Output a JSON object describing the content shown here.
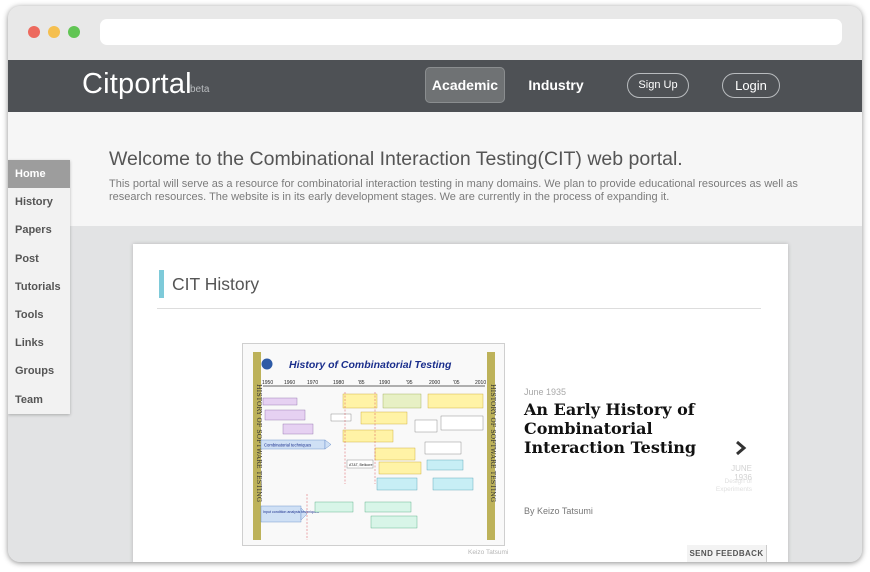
{
  "window": {
    "controls": {
      "close_color": "#ed6a5e",
      "minimize_color": "#f5bf4f",
      "zoom_color": "#61c554"
    },
    "address_bar": ""
  },
  "nav": {
    "brand": "Citportal",
    "beta": "beta",
    "tabs": [
      {
        "label": "Academic",
        "active": true
      },
      {
        "label": "Industry",
        "active": false
      }
    ],
    "sign_up": "Sign Up",
    "login": "Login"
  },
  "hero": {
    "title": "Welcome to the Combinational Interaction Testing(CIT) web portal.",
    "text": "This portal will serve as a resource for combinatorial interaction testing in many domains. We plan to provide educational resources as well as research resources. The website is in its early development stages. We are currently in the process of expanding it."
  },
  "sidebar": {
    "items": [
      {
        "label": "Home",
        "active": true
      },
      {
        "label": "History"
      },
      {
        "label": "Papers"
      },
      {
        "label": "Post"
      },
      {
        "label": "Tutorials"
      },
      {
        "label": "Tools"
      },
      {
        "label": "Links"
      },
      {
        "label": "Groups"
      },
      {
        "label": "Team"
      }
    ]
  },
  "section": {
    "title": "CIT History",
    "accent_color": "#7ecad9"
  },
  "slide": {
    "poster": {
      "title": "History of Combinatorial Testing",
      "years": [
        "1950",
        "1960",
        "1970",
        "1980",
        "'85",
        "1990",
        "'95",
        "2000",
        "'05",
        "2010"
      ],
      "side_text": "HISTORY OF SOFTWARE TESTING",
      "labels": [
        "Combinatorial techniques",
        "AT&T, Bellcore",
        "Input condition analysis techniques"
      ]
    },
    "credit": "Keizo Tatsumi",
    "date": "June 1935",
    "title": "An Early History of Combinatorial Interaction Testing",
    "byline": "By Keizo Tatsumi",
    "next": {
      "date": "JUNE 1936",
      "title": "Design of Experiments",
      "icon": "chevron-right-icon"
    }
  },
  "feedback": "SEND FEEDBACK"
}
